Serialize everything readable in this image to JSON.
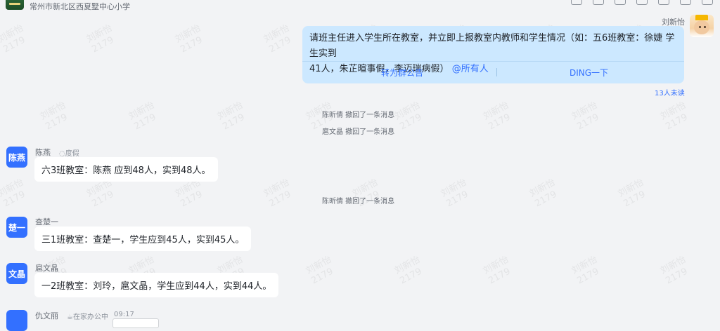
{
  "header": {
    "group_name": "常州市新北区西夏墅中心小学",
    "toolbar_icons": [
      "edit-icon",
      "download-icon",
      "mute-icon",
      "list-icon",
      "add-member-icon",
      "search-icon",
      "settings-icon"
    ]
  },
  "self_message": {
    "sender": "刘新怡",
    "text_line1": "请班主任进入学生所在教室，并立即上报教室内教师和学生情况（如：五6班教室：徐婕 学生实到",
    "text_line2": "41人，朱芷暄事假，李迈瑞病假）",
    "mention": "@所有人",
    "action_left": "转为群公告",
    "action_right": "DING一下",
    "read_status": "13人未读"
  },
  "system_messages": [
    "陈昕倩 撤回了一条消息",
    "扈文晶 撤回了一条消息",
    "陈昕倩 撤回了一条消息"
  ],
  "messages": [
    {
      "avatar": "陈燕",
      "sender": "陈燕",
      "status": "度假",
      "text": "六3班教室：陈燕 应到48人，实到48人。"
    },
    {
      "avatar": "楚一",
      "sender": "查楚一",
      "status": "",
      "text": "三1班教室：查楚一，学生应到45人，实到45人。"
    },
    {
      "avatar": "文晶",
      "sender": "扈文晶",
      "status": "",
      "text": "一2班教室：刘玲，扈文晶，学生应到44人，实到44人。"
    },
    {
      "avatar": "",
      "sender": "仇文丽",
      "status": "在家办公中",
      "time": "09:17"
    }
  ],
  "watermark": [
    "刘新怡",
    "2179"
  ],
  "colors": {
    "accent": "#3370ff",
    "self_bubble": "#cce8ff",
    "background": "#f2f3f5"
  }
}
